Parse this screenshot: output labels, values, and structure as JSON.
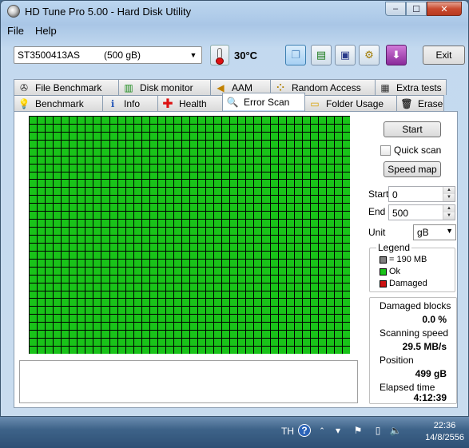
{
  "window": {
    "title": "HD Tune Pro 5.00 - Hard Disk Utility",
    "controls": {
      "minimize": "–",
      "maximize": "☐",
      "close": "✕"
    }
  },
  "menu": {
    "file": "File",
    "help": "Help"
  },
  "toolbar": {
    "drive_name": "ST3500413AS",
    "drive_size": "(500 gB)",
    "temperature": "30",
    "temperature_unit": "°C",
    "exit_label": "Exit",
    "icons": [
      "copy-icon",
      "copy-info-icon",
      "save-icon",
      "options-icon",
      "download-icon"
    ]
  },
  "tabs": {
    "back": [
      "File Benchmark",
      "Disk monitor",
      "AAM",
      "Random Access",
      "Extra tests"
    ],
    "front": [
      "Benchmark",
      "Info",
      "Health",
      "Error Scan",
      "Folder Usage",
      "Erase"
    ],
    "selected": "Error Scan"
  },
  "scan": {
    "grid_cols": 40,
    "grid_rows": 30,
    "block_color": "#19c319",
    "grid_line_color": "#000000",
    "damaged_blocks_count": 0
  },
  "controls": {
    "start_button": "Start",
    "quick_scan_label": "Quick scan",
    "quick_scan_checked": false,
    "speed_map_button": "Speed map",
    "start_label": "Start",
    "start_value": "0",
    "end_label": "End",
    "end_value": "500",
    "unit_label": "Unit",
    "unit_value": "gB"
  },
  "legend": {
    "title": "Legend",
    "items": [
      {
        "label": "= 190 MB",
        "color": "#808080"
      },
      {
        "label": "Ok",
        "color": "#19c319"
      },
      {
        "label": "Damaged",
        "color": "#cc1111"
      }
    ]
  },
  "stats": {
    "damaged_blocks_label": "Damaged blocks",
    "damaged_blocks_value": "0.0 %",
    "scanning_speed_label": "Scanning speed",
    "scanning_speed_value": "29.5 MB/s",
    "position_label": "Position",
    "position_value": "499 gB",
    "elapsed_label": "Elapsed time",
    "elapsed_value": "4:12:39"
  },
  "taskbar": {
    "language": "TH",
    "time": "22:36",
    "date": "14/8/2556",
    "tray_icons": [
      "help-icon",
      "arrow-up-icon",
      "flag-icon",
      "network-icon",
      "volume-icon"
    ]
  }
}
